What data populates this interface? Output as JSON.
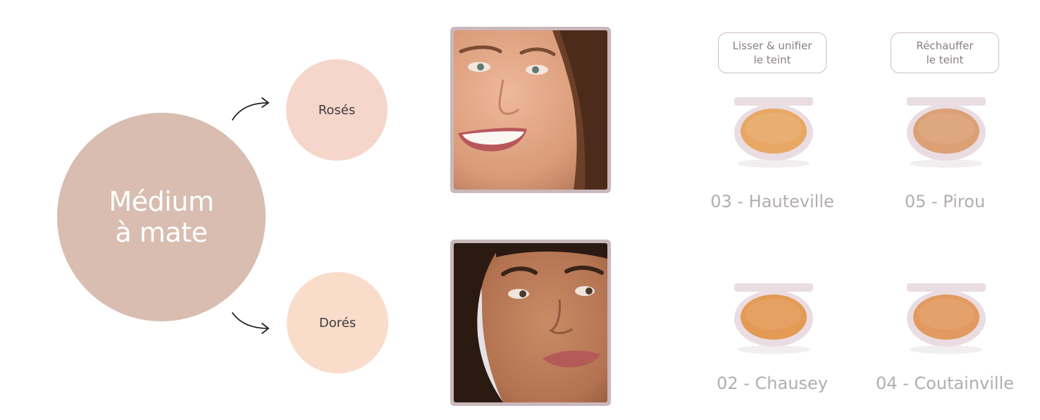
{
  "skin_tone": {
    "label": "Médium\nà mate",
    "color": "#d8bdb0"
  },
  "undertones": [
    {
      "label": "Rosés",
      "color": "#f6d6cb"
    },
    {
      "label": "Dorés",
      "color": "#fadccb"
    }
  ],
  "benefits": [
    {
      "label": "Lisser & unifier\nle teint"
    },
    {
      "label": "Réchauffer\nle teint"
    }
  ],
  "shades": [
    {
      "name": "03 - Hauteville",
      "color": "#e8a865"
    },
    {
      "name": "05 - Pirou",
      "color": "#dba175"
    },
    {
      "name": "02 - Chausey",
      "color": "#e39a55"
    },
    {
      "name": "04 - Coutainville",
      "color": "#e29a60"
    }
  ],
  "colors": {
    "compact_case": "#eadde2",
    "frame": "#c9b8bb",
    "shade_text": "#b3adb0"
  }
}
